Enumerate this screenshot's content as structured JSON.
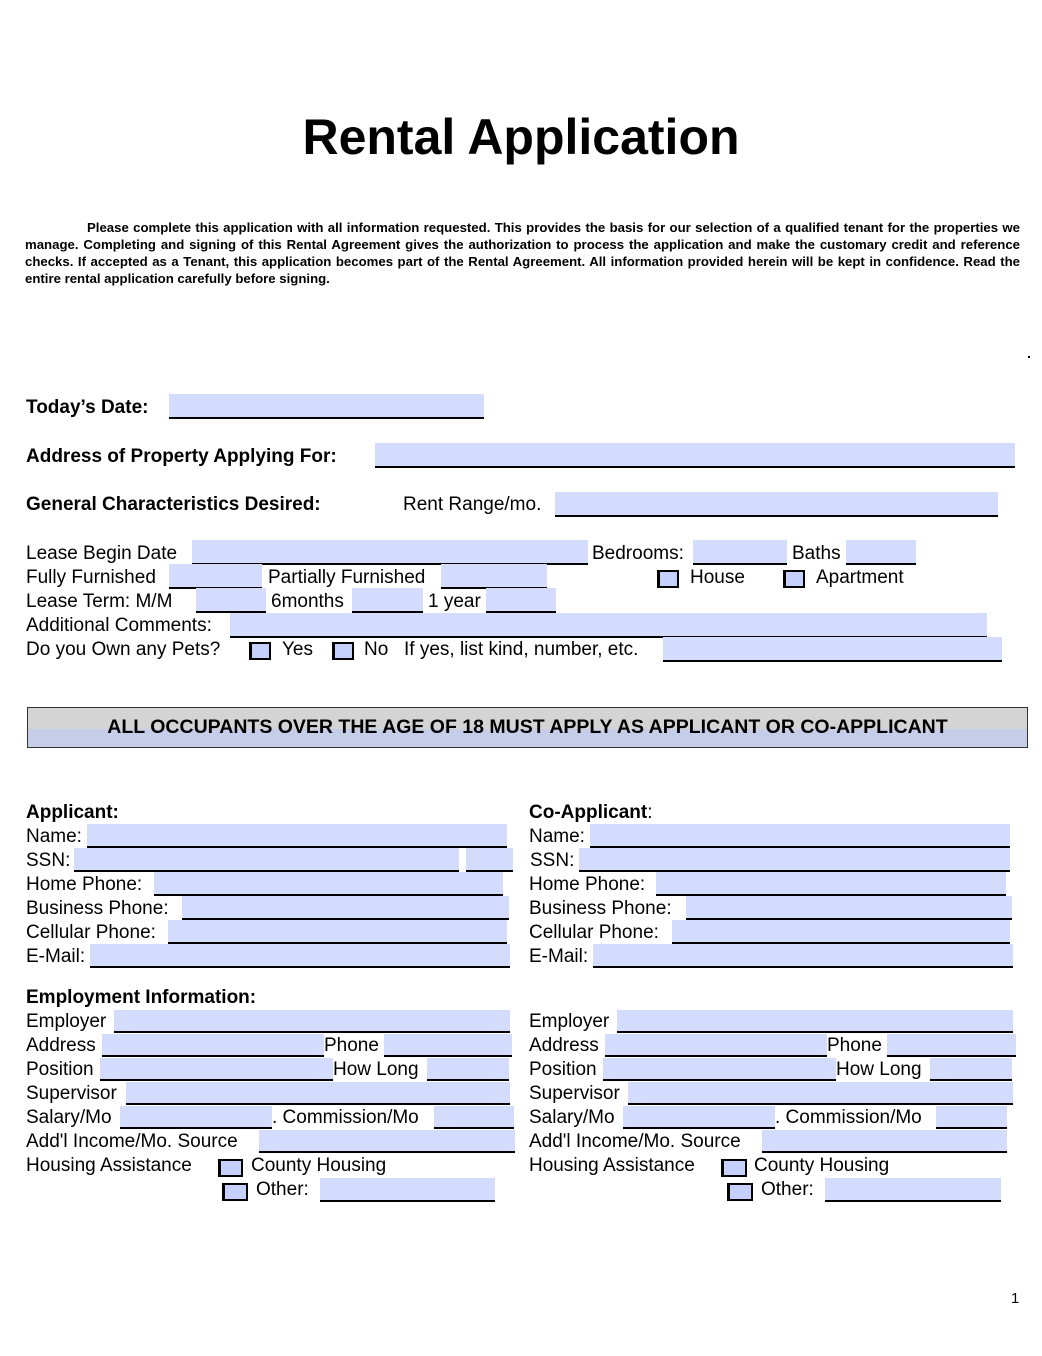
{
  "title": "Rental Application",
  "intro_paragraph": "Please complete this application with all information requested.  This provides the basis for our selection of a qualified tenant for the properties we manage.  Completing and signing of this Rental Agreement gives the authorization to process the application and make the customary credit and reference checks.  If accepted as a Tenant, this application becomes part of the Rental Agreement. All information provided herein will be kept in confidence.  Read the entire rental application carefully before signing.",
  "property": {
    "todays_date_label": "Today’s Date:",
    "todays_date_value": "",
    "address_label": "Address of Property Applying For:",
    "address_value": "",
    "general_label": "General Characteristics Desired:",
    "rent_range_label": "Rent Range/mo.",
    "rent_range_value": "",
    "lease_begin_label": "Lease Begin Date",
    "lease_begin_value": "",
    "bedrooms_label": "Bedrooms:",
    "bedrooms_value": "",
    "baths_label": "Baths",
    "baths_value": "",
    "fully_furnished_label": "Fully Furnished",
    "fully_furnished_value": "",
    "partially_furnished_label": "Partially Furnished",
    "partially_furnished_value": "",
    "house_label": "House",
    "house_checked": false,
    "apartment_label": "Apartment",
    "apartment_checked": false,
    "lease_term_label": "Lease Term:  M/M",
    "lease_mm_value": "",
    "six_months_label": "6months",
    "six_months_value": "",
    "one_year_label": "1 year",
    "one_year_value": "",
    "comments_label": "Additional Comments:",
    "comments_value": "",
    "pets_label": "Do you Own any Pets?",
    "pets_yes_label": "Yes",
    "pets_yes_checked": false,
    "pets_no_label": "No",
    "pets_no_checked": false,
    "pets_details_label": "If yes, list kind, number, etc.",
    "pets_details_value": ""
  },
  "banner": "ALL OCCUPANTS OVER THE AGE OF 18 MUST APPLY AS APPLICANT OR CO-APPLICANT",
  "applicant": {
    "heading": "Applicant:",
    "name_label": "Name:",
    "ssn_label": "SSN:",
    "home_phone_label": "Home Phone:",
    "business_phone_label": "Business Phone:",
    "cellular_phone_label": "Cellular Phone:",
    "email_label": "E-Mail:"
  },
  "co_applicant": {
    "heading": "Co-Applicant",
    "heading_colon": ":",
    "name_label": "Name:",
    "ssn_label": "SSN:",
    "home_phone_label": "Home Phone:",
    "business_phone_label": "Business Phone:",
    "cellular_phone_label": "Cellular Phone:",
    "email_label": "E-Mail:"
  },
  "employment": {
    "heading": "Employment Information:",
    "employer_label": "Employer",
    "address_label": "Address",
    "phone_label": "Phone",
    "position_label": "Position",
    "how_long_label": "How Long",
    "supervisor_label": "Supervisor",
    "salary_label": "Salary/Mo",
    "commission_label": ". Commission/Mo",
    "addl_income_label": "Add'l Income/Mo. Source",
    "housing_assistance_label": "Housing Assistance",
    "county_housing_label": "County Housing",
    "other_label": "Other:"
  },
  "page_number": "1"
}
